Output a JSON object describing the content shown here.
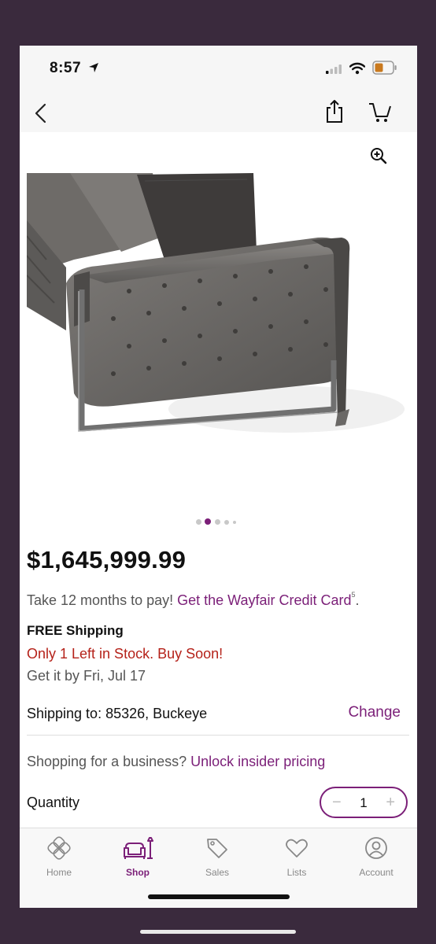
{
  "status_bar": {
    "time": "8:57"
  },
  "product": {
    "price": "$1,645,999.99"
  },
  "financing": {
    "prefix": "Take 12 months to pay! ",
    "link": "Get the Wayfair Credit Card",
    "superscript": "5",
    "suffix": "."
  },
  "shipping": {
    "free": "FREE Shipping",
    "stock": "Only 1 Left in Stock. Buy Soon!",
    "delivery": "Get it by Fri, Jul 17",
    "destination": "Shipping to: 85326, Buckeye",
    "change_label": "Change"
  },
  "business": {
    "prefix": "Shopping for a business? ",
    "link": "Unlock insider pricing"
  },
  "quantity": {
    "label": "Quantity",
    "value": "1",
    "minus": "−",
    "plus": "+"
  },
  "tabs": [
    {
      "label": "Home",
      "icon": "home-icon"
    },
    {
      "label": "Shop",
      "icon": "shop-icon"
    },
    {
      "label": "Sales",
      "icon": "tag-icon"
    },
    {
      "label": "Lists",
      "icon": "heart-icon"
    },
    {
      "label": "Account",
      "icon": "account-icon"
    }
  ],
  "colors": {
    "accent": "#7b1f78",
    "stock_warning": "#b5221a",
    "bezel": "#3a2a3d"
  }
}
